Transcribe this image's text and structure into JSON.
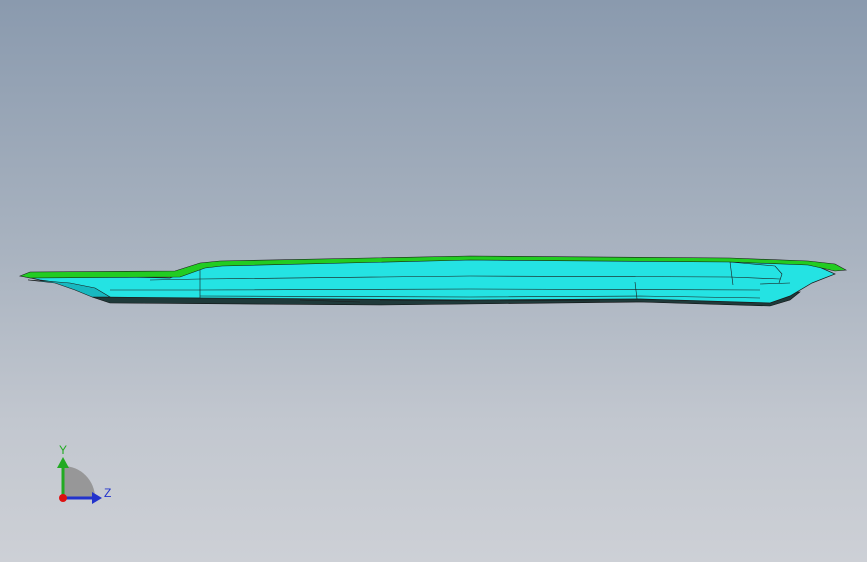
{
  "viewport": {
    "background_top": "#8a9aae",
    "background_bottom": "#cdd0d6"
  },
  "model": {
    "shape": "flat tray part viewed edge-on",
    "edge_color": "#22cc22",
    "face_color": "#22e0e0",
    "line_color": "#1a1a1a"
  },
  "triad": {
    "y_label": "Y",
    "z_label": "Z",
    "y_color": "#22aa22",
    "z_color": "#2233cc",
    "x_color": "#dd1111"
  }
}
